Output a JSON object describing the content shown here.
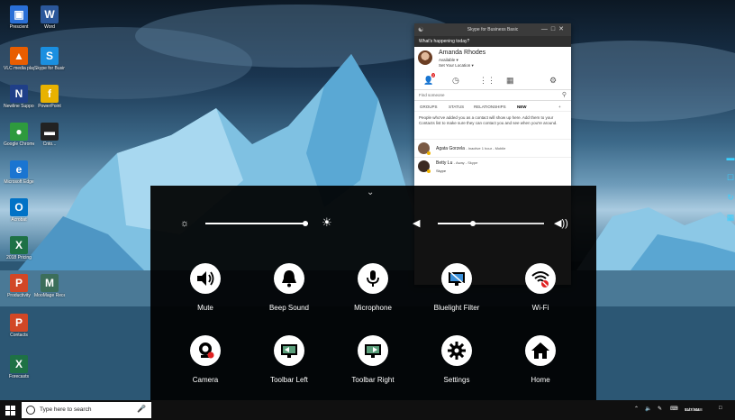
{
  "desktop_icons": [
    {
      "label": "Prescient",
      "icon": "bin-icon",
      "color": "#2a6fd6",
      "glyph": "▣"
    },
    {
      "label": "Word",
      "icon": "word-icon",
      "color": "#2b579a",
      "glyph": "W"
    },
    {
      "label": "VLC media player",
      "icon": "vlc-icon",
      "color": "#e85d00",
      "glyph": "▲"
    },
    {
      "label": "Skype for Business",
      "icon": "skype-icon",
      "color": "#1a8fe0",
      "glyph": "S"
    },
    {
      "label": "Newline Support",
      "icon": "newline-icon",
      "color": "#1f3f88",
      "glyph": "N"
    },
    {
      "label": "PowerPoint",
      "icon": "folder-icon",
      "color": "#e8b200",
      "glyph": "f"
    },
    {
      "label": "Google Chrome",
      "icon": "chrome-icon",
      "color": "#2e9a3e",
      "glyph": "●"
    },
    {
      "label": "Cnto...",
      "icon": "app-icon",
      "color": "#222222",
      "glyph": "▬"
    },
    {
      "label": "Microsoft Edge",
      "icon": "edge-icon",
      "color": "#1a75d1",
      "glyph": "e"
    },
    {
      "label": "Acrobat",
      "icon": "outlook-icon",
      "color": "#0072c6",
      "glyph": "O"
    },
    {
      "label": "2018 Pricing",
      "icon": "excel-icon",
      "color": "#1e7145",
      "glyph": "X"
    },
    {
      "label": "Productivity",
      "icon": "powerpoint-icon",
      "color": "#d24726",
      "glyph": "P"
    },
    {
      "label": "MooMage Receiver",
      "icon": "receiver-icon",
      "color": "#3c6e5a",
      "glyph": "M"
    },
    {
      "label": "Contacts",
      "icon": "powerpoint-icon-2",
      "color": "#d24726",
      "glyph": "P"
    },
    {
      "label": "Forecasts",
      "icon": "excel-icon-2",
      "color": "#1e7145",
      "glyph": "X"
    }
  ],
  "skype": {
    "title": "Skype for Business Basic",
    "whats_happening": "What's happening today?",
    "user_name": "Amanda Rhodes",
    "user_status": "Available",
    "location": "Set Your Location",
    "badge": "2",
    "search_placeholder": "Find someone",
    "tabs": [
      "GROUPS",
      "STATUS",
      "RELATIONSHIPS",
      "NEW"
    ],
    "info": "People who've added you as a contact will show up here. Add them to your Contacts list to make sure they can contact you and see when you're around.",
    "contacts": [
      {
        "name": "Agata Gorzela",
        "status": "- Inactive 1 hour - Mobile",
        "sub": ""
      },
      {
        "name": "Betty Lu",
        "status": "- Away - Skype",
        "sub": "Skype"
      }
    ]
  },
  "toolbar": {
    "brightness_level": 0.97,
    "volume_level": 0.33,
    "buttons_row1": [
      {
        "label": "Mute",
        "icon": "speaker-icon"
      },
      {
        "label": "Beep Sound",
        "icon": "bell-icon"
      },
      {
        "label": "Microphone",
        "icon": "microphone-icon"
      },
      {
        "label": "Bluelight Filter",
        "icon": "monitor-filter-icon"
      },
      {
        "label": "Wi-Fi",
        "icon": "wifi-off-icon"
      }
    ],
    "buttons_row2": [
      {
        "label": "Camera",
        "icon": "camera-icon"
      },
      {
        "label": "Toolbar Left",
        "icon": "toolbar-left-icon"
      },
      {
        "label": "Toolbar Right",
        "icon": "toolbar-right-icon"
      },
      {
        "label": "Settings",
        "icon": "gear-icon"
      },
      {
        "label": "Home",
        "icon": "home-icon"
      }
    ]
  },
  "taskbar": {
    "search_placeholder": "Type here to search",
    "time": "9:47 AM",
    "date": "11/7/2018"
  }
}
